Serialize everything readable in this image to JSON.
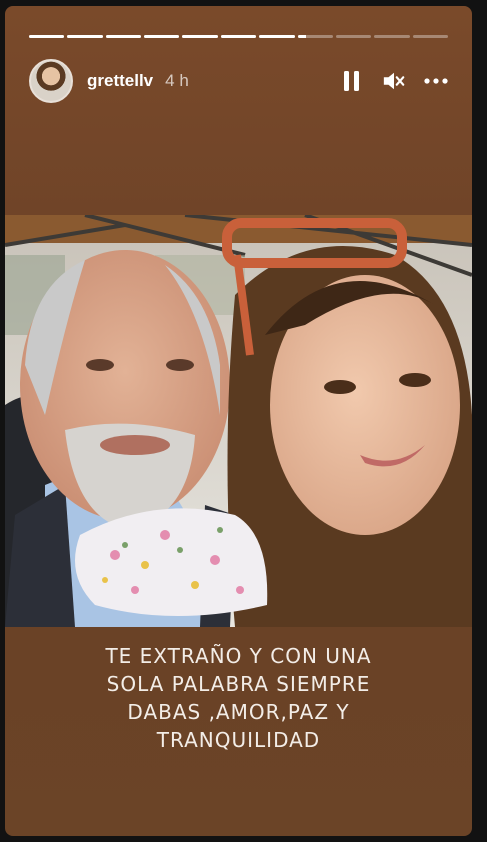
{
  "story": {
    "progress_segments": [
      1,
      1,
      1,
      1,
      1,
      1,
      1,
      0.25,
      0,
      0,
      0
    ],
    "user": {
      "username": "grettellv",
      "time": "4 h"
    },
    "controls": {
      "pause_icon": "pause-icon",
      "mute_icon": "mute-icon",
      "more_icon": "more-icon"
    },
    "caption": {
      "lines": [
        "TE EXTRAÑO Y CON UNA",
        "SOLA PALABRA SIEMPRE",
        "DABAS ,AMOR,PAZ Y",
        "TRANQUILIDAD"
      ]
    },
    "colors": {
      "background": "#6d4327",
      "text": "#f3ede7"
    }
  }
}
